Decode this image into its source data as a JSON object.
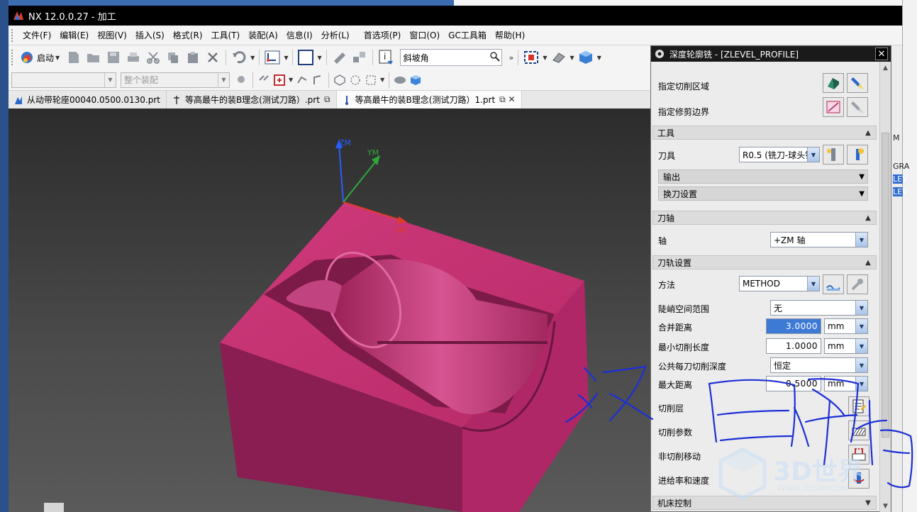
{
  "window": {
    "title": "NX 12.0.0.27 - 加工"
  },
  "menu": [
    "文件(F)",
    "编辑(E)",
    "视图(V)",
    "插入(S)",
    "格式(R)",
    "工具(T)",
    "装配(A)",
    "信息(I)",
    "分析(L)",
    "首选项(P)",
    "窗口(O)",
    "GC工具箱",
    "帮助(H)"
  ],
  "toolbar": {
    "start_label": "启动",
    "search_value": "斜坡角"
  },
  "toolbar2": {
    "filter_value": "",
    "assembly_placeholder": "整个装配"
  },
  "tabs": [
    {
      "label": "从动带轮座00040.0500.0130.prt",
      "suffix": ""
    },
    {
      "label": "等高最牛的装B理念(测试刀路）.prt",
      "suffix": "⧉"
    },
    {
      "label": "等高最牛的装B理念(测试刀路）1.prt",
      "suffix": "⧉ ✕"
    }
  ],
  "viewport": {
    "axes": {
      "zm": "ZM",
      "ym": "YM",
      "xm": "XM"
    },
    "colors": {
      "part": "#c2306e",
      "part_dark": "#8c1f4f",
      "axis_z": "#2a5cff",
      "axis_y": "#2fa83a",
      "axis_x": "#e03b2a"
    }
  },
  "dialog": {
    "title": "深度轮廓铣 - [ZLEVEL_PROFILE]",
    "geometry_rows": {
      "row0": "指定切削区域",
      "row1": "指定修剪边界"
    },
    "tool_section": {
      "title": "工具",
      "tool_label": "刀具",
      "tool_value": "R0.5 (铣刀-球头铣",
      "output_label": "输出",
      "change_label": "换刀设置"
    },
    "axis_section": {
      "title": "刀轴",
      "axis_label": "轴",
      "axis_value": "+ZM 轴"
    },
    "path_section": {
      "title": "刀轨设置",
      "method_label": "方法",
      "method_value": "METHOD",
      "steep_label": "陡峭空间范围",
      "steep_value": "无",
      "merge_label": "合并距离",
      "merge_value": "3.0000",
      "merge_unit": "mm",
      "min_cut_label": "最小切削长度",
      "min_cut_value": "1.0000",
      "min_cut_unit": "mm",
      "depth_label": "公共每刀切削深度",
      "depth_value": "恒定",
      "max_dist_label": "最大距离",
      "max_dist_value": "0.5000",
      "max_dist_unit": "mm",
      "levels_label": "切削层",
      "params_label": "切削参数",
      "noncut_label": "非切削移动",
      "feeds_label": "进给率和速度"
    },
    "machine_section": {
      "title": "机床控制"
    }
  },
  "right_strip": [
    "M",
    "GRA",
    "LEV",
    "LEV"
  ],
  "watermark": {
    "brand": "3D世界",
    "url": "WWW.3DSJW.COM"
  }
}
